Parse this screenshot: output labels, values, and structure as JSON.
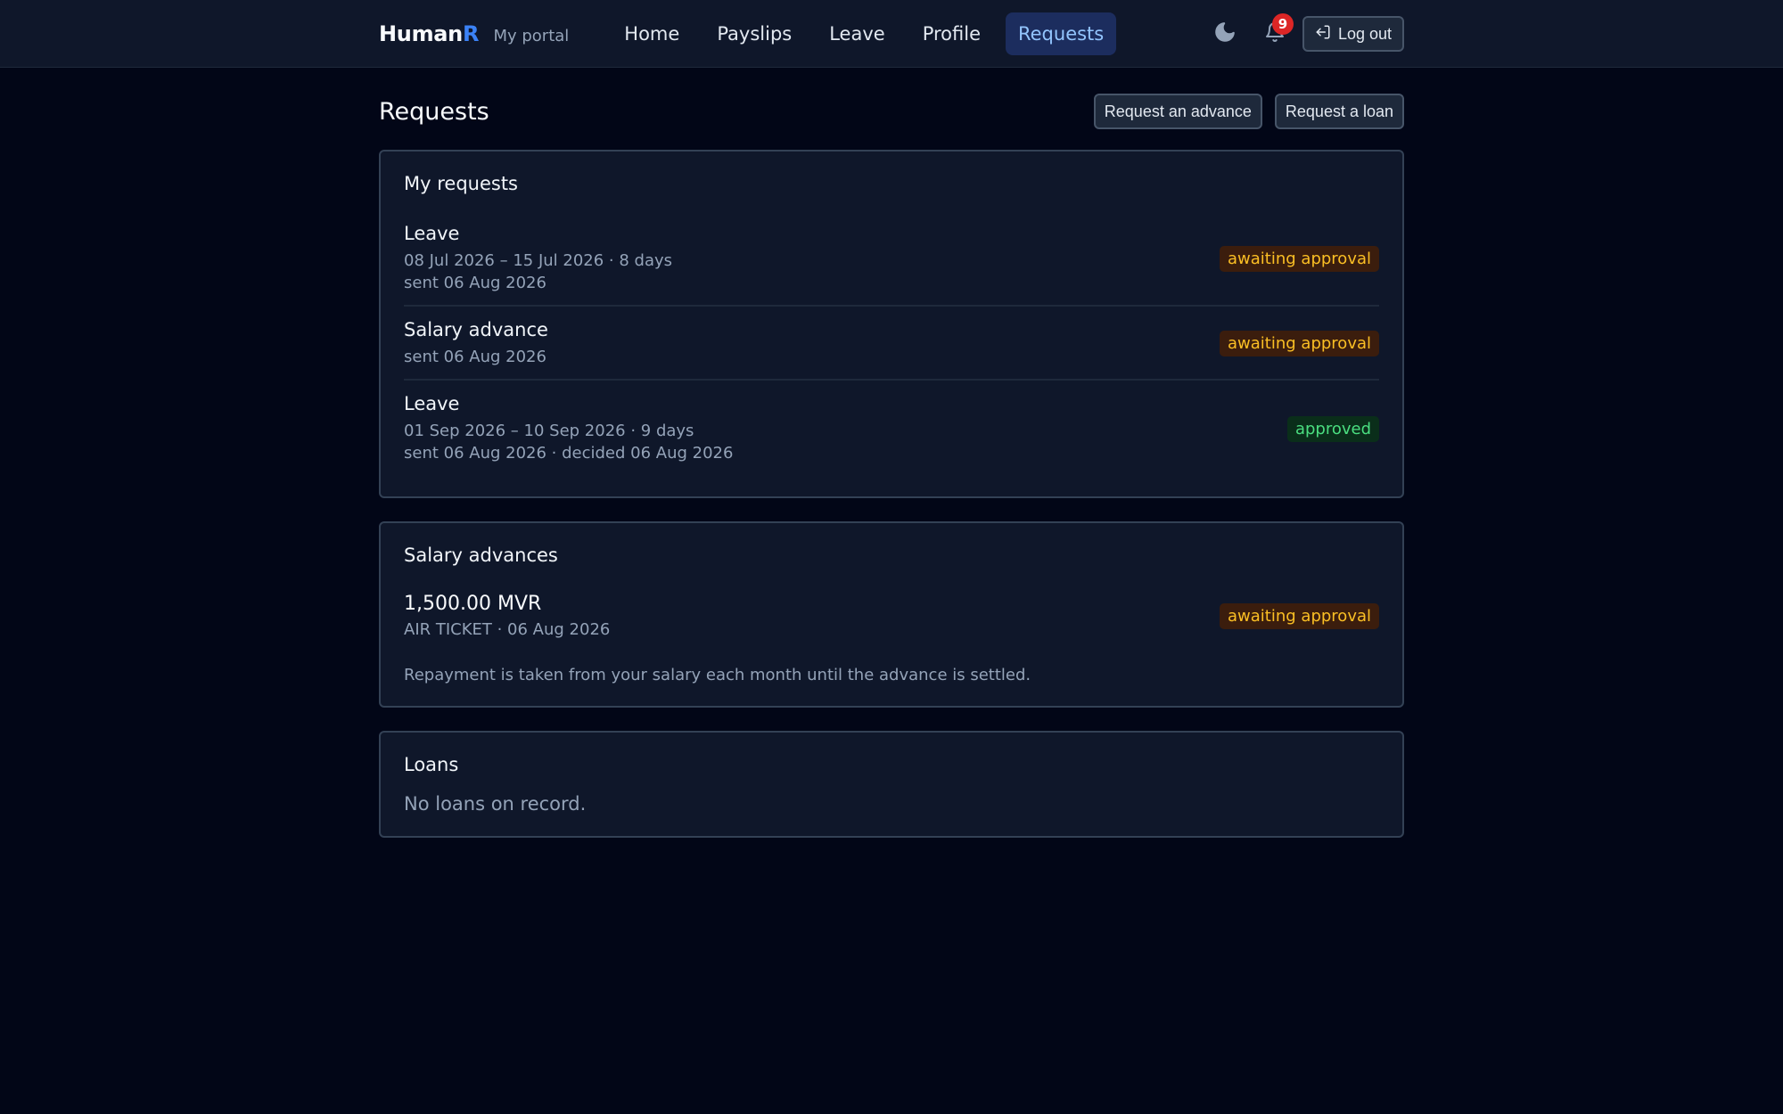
{
  "nav": {
    "brand_name": "Human",
    "brand_accent": "R",
    "brand_sub": "My portal",
    "items": [
      {
        "label": "Home",
        "active": false
      },
      {
        "label": "Payslips",
        "active": false
      },
      {
        "label": "Leave",
        "active": false
      },
      {
        "label": "Profile",
        "active": false
      },
      {
        "label": "Requests",
        "active": true
      }
    ],
    "notification_count": "9",
    "logout_label": "Log out"
  },
  "page": {
    "title": "Requests",
    "request_advance_label": "Request an advance",
    "request_loan_label": "Request a loan"
  },
  "my_requests": {
    "title": "My requests",
    "items": [
      {
        "title": "Leave",
        "line1": "08 Jul 2026 – 15 Jul 2026 · 8 days",
        "line2": "sent 06 Aug 2026",
        "status": "awaiting approval"
      },
      {
        "title": "Salary advance",
        "line1": "sent 06 Aug 2026",
        "status": "awaiting approval"
      },
      {
        "title": "Leave",
        "line1": "01 Sep 2026 – 10 Sep 2026 · 9 days",
        "line2": "sent 06 Aug 2026 · decided 06 Aug 2026",
        "status": "approved"
      }
    ]
  },
  "salary_advances": {
    "title": "Salary advances",
    "amount": "1,500.00 MVR",
    "meta": "AIR TICKET · 06 Aug 2026",
    "status": "awaiting approval",
    "note": "Repayment is taken from your salary each month until the advance is settled."
  },
  "loans": {
    "title": "Loans",
    "empty_text": "No loans on record."
  },
  "colors": {
    "background": "#020617",
    "card": "#0f172a",
    "accent": "#3b82f6",
    "pending": "#fbbf24",
    "approved": "#4ade80",
    "badge": "#dc2626"
  }
}
